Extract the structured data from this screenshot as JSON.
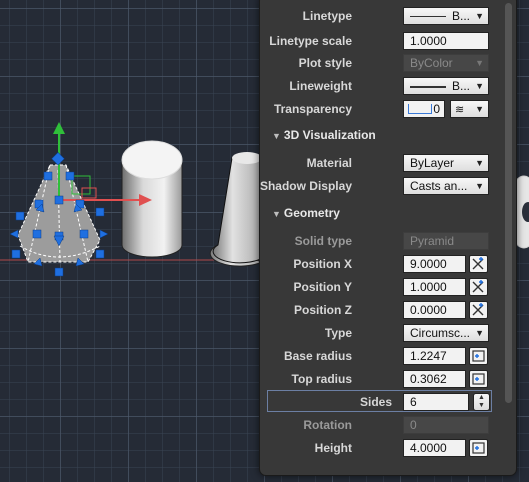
{
  "properties": {
    "linetype": {
      "label": "Linetype",
      "value": "B..."
    },
    "linetype_scale": {
      "label": "Linetype scale",
      "value": "1.0000"
    },
    "plot_style": {
      "label": "Plot style",
      "value": "ByColor"
    },
    "lineweight": {
      "label": "Lineweight",
      "value": "B..."
    },
    "transparency": {
      "label": "Transparency",
      "value": "0"
    },
    "sections": {
      "visualization": "3D Visualization",
      "geometry": "Geometry"
    },
    "material": {
      "label": "Material",
      "value": "ByLayer"
    },
    "shadow_display": {
      "label": "Shadow Display",
      "value": "Casts an..."
    },
    "solid_type": {
      "label": "Solid type",
      "value": "Pyramid"
    },
    "position_x": {
      "label": "Position X",
      "value": "9.0000"
    },
    "position_y": {
      "label": "Position Y",
      "value": "1.0000"
    },
    "position_z": {
      "label": "Position Z",
      "value": "0.0000"
    },
    "type": {
      "label": "Type",
      "value": "Circumsc..."
    },
    "base_radius": {
      "label": "Base radius",
      "value": "1.2247"
    },
    "top_radius": {
      "label": "Top radius",
      "value": "0.3062"
    },
    "sides": {
      "label": "Sides",
      "value": "6"
    },
    "rotation": {
      "label": "Rotation",
      "value": "0"
    },
    "height": {
      "label": "Height",
      "value": "4.0000"
    }
  },
  "colors": {
    "grip_blue": "#1f6fe0",
    "axis_x": "#e05050",
    "axis_y": "#2fbf3a",
    "palette_bg": "#383838",
    "grid": "#505c6e"
  },
  "icons": [
    "pick-point-icon",
    "quick-select-icon",
    "chevron-down-icon",
    "stepper-icon"
  ]
}
